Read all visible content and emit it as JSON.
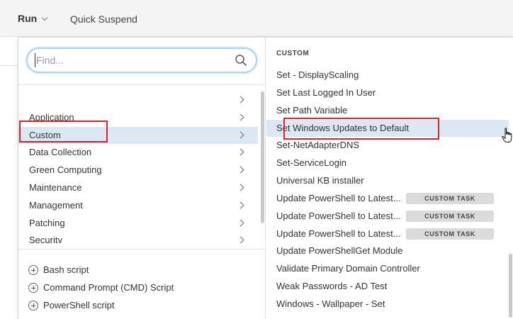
{
  "toolbar": {
    "run_label": "Run",
    "quick_suspend_label": "Quick Suspend"
  },
  "search": {
    "placeholder": "Find...",
    "value": ""
  },
  "categories": [
    {
      "label": ""
    },
    {
      "label": "Application"
    },
    {
      "label": "Custom",
      "selected": true
    },
    {
      "label": "Data Collection"
    },
    {
      "label": "Green Computing"
    },
    {
      "label": "Maintenance"
    },
    {
      "label": "Management"
    },
    {
      "label": "Patching"
    },
    {
      "label": "Security"
    }
  ],
  "scripts": [
    {
      "label": "Bash script"
    },
    {
      "label": "Command Prompt (CMD) Script"
    },
    {
      "label": "PowerShell script"
    }
  ],
  "tasks_panel": {
    "header": "CUSTOM",
    "tasks": [
      {
        "label": "Set - DisplayScaling",
        "badge": ""
      },
      {
        "label": "Set Last Logged In User",
        "badge": ""
      },
      {
        "label": "Set Path Variable",
        "badge": ""
      },
      {
        "label": "Set Windows Updates to Default",
        "badge": "",
        "selected": true
      },
      {
        "label": "Set-NetAdapterDNS",
        "badge": ""
      },
      {
        "label": "Set-ServiceLogin",
        "badge": ""
      },
      {
        "label": "Universal KB installer",
        "badge": ""
      },
      {
        "label": "Update PowerShell to Latest...",
        "badge": "CUSTOM TASK"
      },
      {
        "label": "Update PowerShell to Latest...",
        "badge": "CUSTOM TASK"
      },
      {
        "label": "Update PowerShell to Latest...",
        "badge": "CUSTOM TASK"
      },
      {
        "label": "Update PowerShellGet Module",
        "badge": ""
      },
      {
        "label": "Validate Primary Domain Controller",
        "badge": ""
      },
      {
        "label": "Weak Passwords - AD Test",
        "badge": ""
      },
      {
        "label": "Windows - Wallpaper - Set",
        "badge": ""
      }
    ]
  },
  "colors": {
    "selection": "#dbe8f3",
    "highlight_border": "#d9232a",
    "search_focus": "#a9d3f5"
  }
}
